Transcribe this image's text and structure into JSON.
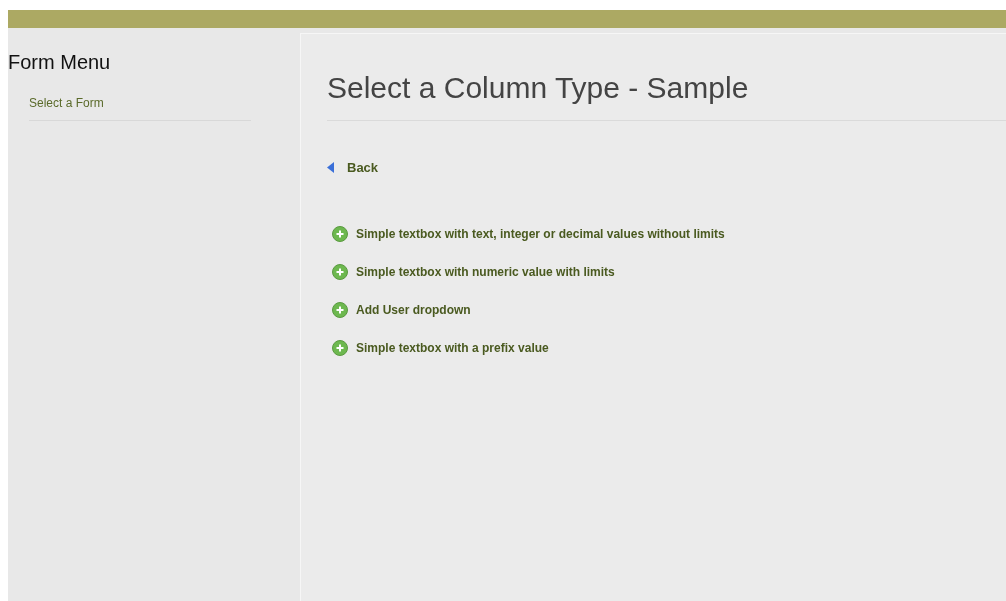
{
  "sidebar": {
    "title": "Form Menu",
    "items": [
      {
        "label": "Select a Form"
      }
    ]
  },
  "main": {
    "title": "Select a Column Type - Sample",
    "back": "Back",
    "options": [
      {
        "label": "Simple textbox with text, integer or decimal values without limits"
      },
      {
        "label": "Simple textbox with numeric value with limits"
      },
      {
        "label": "Add User dropdown"
      },
      {
        "label": "Simple textbox with a prefix value"
      }
    ]
  }
}
